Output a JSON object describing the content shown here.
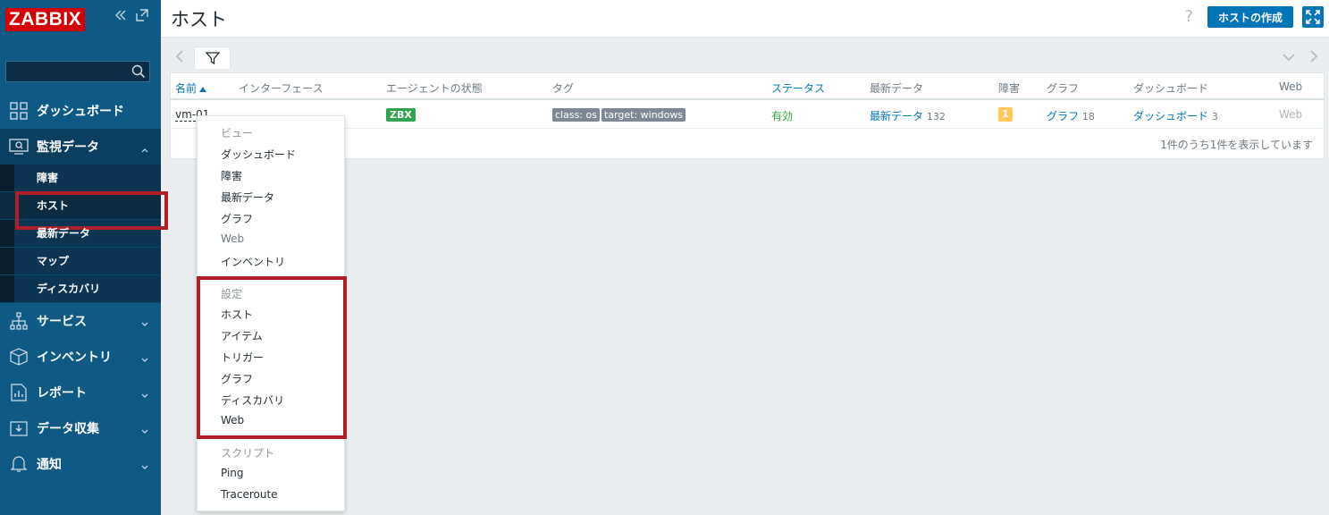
{
  "app": {
    "logo": "ZABBIX"
  },
  "search": {
    "placeholder": ""
  },
  "sidebar": {
    "items": [
      {
        "label": "ダッシュボード",
        "icon": "dashboard-icon"
      },
      {
        "label": "監視データ",
        "icon": "monitoring-icon",
        "open": true
      },
      {
        "label": "サービス",
        "icon": "services-icon"
      },
      {
        "label": "インベントリ",
        "icon": "inventory-icon"
      },
      {
        "label": "レポート",
        "icon": "reports-icon"
      },
      {
        "label": "データ収集",
        "icon": "data-collection-icon"
      },
      {
        "label": "通知",
        "icon": "alerts-icon"
      }
    ],
    "submenu": [
      "障害",
      "ホスト",
      "最新データ",
      "マップ",
      "ディスカバリ"
    ],
    "active_submenu": "ホスト"
  },
  "header": {
    "title": "ホスト",
    "help": "?",
    "create_label": "ホストの作成"
  },
  "table": {
    "columns": [
      "名前",
      "インターフェース",
      "エージェントの状態",
      "タグ",
      "ステータス",
      "最新データ",
      "障害",
      "グラフ",
      "ダッシュボード",
      "Web"
    ],
    "row": {
      "name": "vm-01",
      "agent": "ZBX",
      "tags": [
        "class: os",
        "target: windows"
      ],
      "status": "有効",
      "latest_label": "最新データ",
      "latest_count": "132",
      "problems": "1",
      "graphs_label": "グラフ",
      "graphs_count": "18",
      "dash_label": "ダッシュボード",
      "dash_count": "3",
      "web": "Web"
    },
    "footer": "1件のうち1件を表示しています"
  },
  "context_menu": {
    "view_header": "ビュー",
    "view_items": [
      "ダッシュボード",
      "障害",
      "最新データ",
      "グラフ",
      "Web",
      "インベントリ"
    ],
    "config_header": "設定",
    "config_items": [
      "ホスト",
      "アイテム",
      "トリガー",
      "グラフ",
      "ディスカバリ",
      "Web"
    ],
    "scripts_header": "スクリプト",
    "script_items": [
      "Ping",
      "Traceroute"
    ]
  },
  "colors": {
    "sidebar": "#0e5a85",
    "accent": "#0275b8",
    "highlight": "#b01e28",
    "ok": "#35a33b",
    "problem": "#ffc859"
  }
}
